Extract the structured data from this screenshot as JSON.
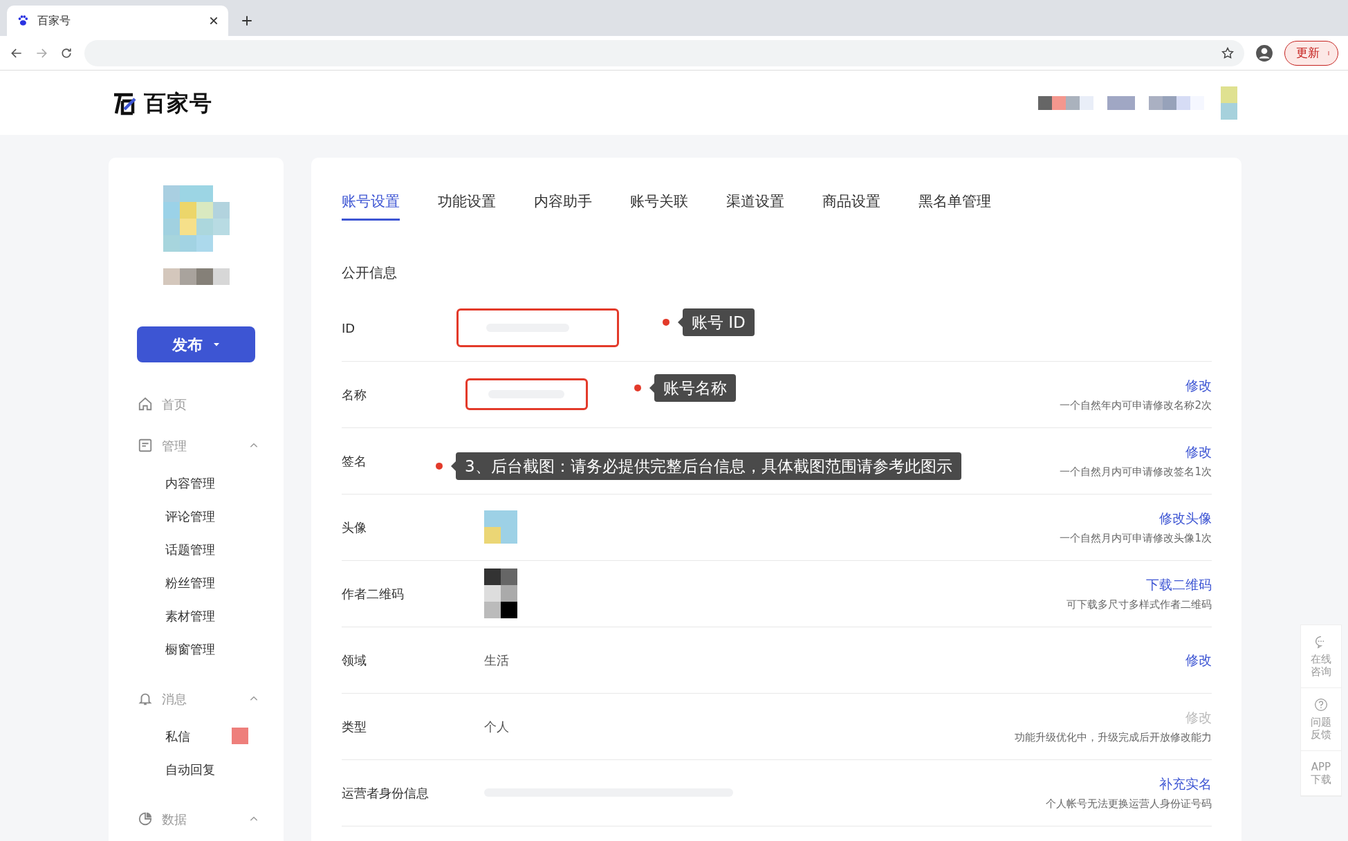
{
  "browser": {
    "tab_title": "百家号",
    "update_button": "更新"
  },
  "header": {
    "logo_text": "百家号"
  },
  "sidebar": {
    "publish_button": "发布",
    "nav": [
      {
        "label": "首页",
        "kind": "item"
      },
      {
        "label": "管理",
        "kind": "group",
        "expanded": true,
        "children": [
          {
            "label": "内容管理"
          },
          {
            "label": "评论管理"
          },
          {
            "label": "话题管理"
          },
          {
            "label": "粉丝管理"
          },
          {
            "label": "素材管理"
          },
          {
            "label": "橱窗管理"
          }
        ]
      },
      {
        "label": "消息",
        "kind": "group",
        "expanded": true,
        "children": [
          {
            "label": "私信",
            "badge": true
          },
          {
            "label": "自动回复"
          }
        ]
      },
      {
        "label": "数据",
        "kind": "group",
        "expanded": true
      }
    ]
  },
  "tabs": [
    {
      "label": "账号设置",
      "selected": true
    },
    {
      "label": "功能设置",
      "selected": false
    },
    {
      "label": "内容助手",
      "selected": false
    },
    {
      "label": "账号关联",
      "selected": false
    },
    {
      "label": "渠道设置",
      "selected": false
    },
    {
      "label": "商品设置",
      "selected": false
    },
    {
      "label": "黑名单管理",
      "selected": false
    }
  ],
  "section_title": "公开信息",
  "rows": [
    {
      "label": "ID",
      "kind": "boxed",
      "callout": "账号 ID"
    },
    {
      "label": "名称",
      "kind": "boxed-short",
      "callout": "账号名称",
      "action": "修改",
      "action_disabled": false,
      "note": "一个自然年内可申请修改名称2次"
    },
    {
      "label": "签名",
      "kind": "blurred",
      "callout": "3、后台截图：请务必提供完整后台信息，具体截图范围请参考此图示",
      "action": "修改",
      "action_disabled": false,
      "note": "一个自然月内可申请修改签名1次"
    },
    {
      "label": "头像",
      "kind": "avatar",
      "action": "修改头像",
      "action_disabled": false,
      "note": "一个自然月内可申请修改头像1次"
    },
    {
      "label": "作者二维码",
      "kind": "qrcode",
      "action": "下载二维码",
      "action_disabled": false,
      "note": "可下载多尺寸多样式作者二维码"
    },
    {
      "label": "领域",
      "kind": "text",
      "value": "生活",
      "action": "修改",
      "action_disabled": false
    },
    {
      "label": "类型",
      "kind": "text",
      "value": "个人",
      "action": "修改",
      "action_disabled": true,
      "note": "功能升级优化中，升级完成后开放修改能力"
    },
    {
      "label": "运营者身份信息",
      "kind": "blurred-long",
      "action": "补充实名",
      "action_disabled": false,
      "note": "个人帐号无法更换运营人身份证号码"
    }
  ],
  "float_panel": [
    {
      "kind": "chat",
      "lines": [
        "在线",
        "咨询"
      ]
    },
    {
      "kind": "help",
      "lines": [
        "问题",
        "反馈"
      ]
    },
    {
      "kind": "none",
      "lines": [
        "APP",
        "下载"
      ]
    }
  ]
}
